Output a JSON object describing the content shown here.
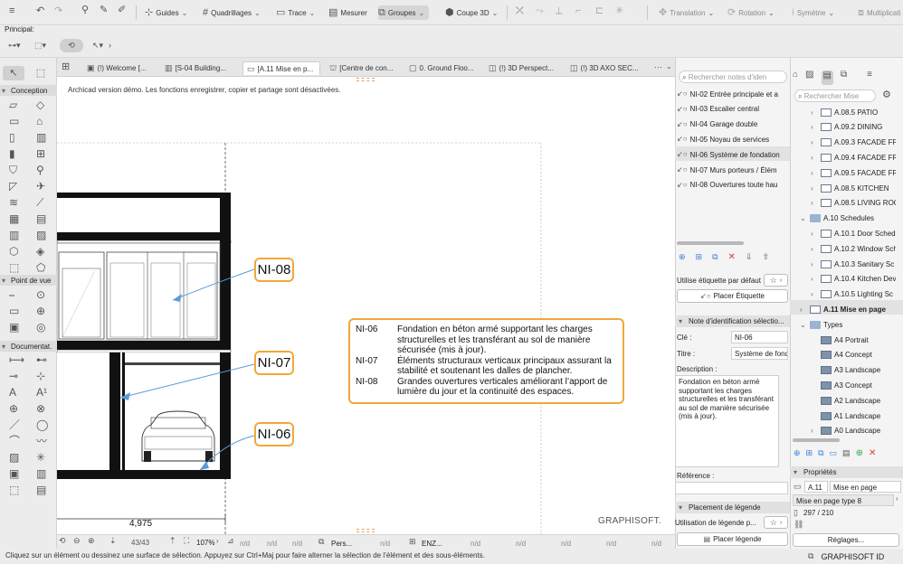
{
  "toolbar": {
    "guides": "Guides",
    "quadrillages": "Quadrillages",
    "trace": "Trace",
    "mesurer": "Mesurer",
    "groupes": "Groupes",
    "coupe3d": "Coupe 3D",
    "translation": "Translation",
    "rotation": "Rotation",
    "symetrie": "Symétrie",
    "multiplication": "Multiplicati"
  },
  "info_box": {
    "label": "Principal:"
  },
  "tabs": [
    {
      "label": "(!) Welcome [..."
    },
    {
      "label": "[S-04 Building..."
    },
    {
      "label": "[A.11 Mise en p..."
    },
    {
      "label": "[Centre de con..."
    },
    {
      "label": "0. Ground Floo..."
    },
    {
      "label": "(!) 3D Perspect..."
    },
    {
      "label": "(!) 3D AXO SEC..."
    }
  ],
  "toolbox": {
    "conception": "Conception",
    "point_de_vue": "Point de vue",
    "documentation": "Documentat."
  },
  "canvas": {
    "demo_notice": "Archicad version démo. Les fonctions enregistrer, copier et partage sont désactivées.",
    "dimension": "4,975",
    "watermark": "GRAPHISOFT.",
    "tags": [
      "NI-08",
      "NI-07",
      "NI-06"
    ],
    "legend": [
      {
        "key": "NI-06",
        "text": "Fondation en béton armé supportant les charges structurelles et les transférant au sol de manière sécurisée (mis à jour)."
      },
      {
        "key": "NI-07",
        "text": "Éléments structuraux verticaux principaux assurant la stabilité et soutenant les dalles de plancher."
      },
      {
        "key": "NI-08",
        "text": "Grandes ouvertures verticales améliorant l’apport de lumière du jour et la continuité des espaces."
      }
    ]
  },
  "status_bar": {
    "page": "43/43",
    "zoom": "107%",
    "na": "n/d",
    "pers": "Pers...",
    "enz": "ENZ..."
  },
  "bottom_hint": "Cliquez sur un élément ou dessinez une surface de sélection. Appuyez sur Ctrl+Maj pour faire alterner la sélection de l’élément et des sous-éléments.",
  "notes_panel": {
    "search_placeholder": "Rechercher notes d'iden",
    "items": [
      "NI-02 Entrée principale et a",
      "NI-03 Escalier central",
      "NI-04 Garage double",
      "NI-05 Noyau de services",
      "NI-06 Système de fondation",
      "NI-07 Murs porteurs / Élém",
      "NI-08 Ouvertures toute hau"
    ],
    "default_tag": "Utilise étiquette par défaut",
    "place_tag": "Placer Étiquette",
    "section_title": "Note d'identification sélectio...",
    "cle_label": "Clé :",
    "cle_value": "NI-06",
    "titre_label": "Titre :",
    "titre_value": "Système de fond",
    "description_label": "Description :",
    "description_value": "Fondation en béton armé supportant les charges structurelles et les transférant au sol de manière sécurisée (mis à jour).",
    "reference_label": "Référence :",
    "placement_title": "Placement de légende",
    "usage_label": "Utilisation de légende p...",
    "place_legend": "Placer légende"
  },
  "navigator": {
    "search_placeholder": "Rechercher Mise",
    "items": [
      "A.08.5 PATIO",
      "A.09.2 DINING",
      "A.09.3 FACADE FR",
      "A.09.4 FACADE FR",
      "A.09.5 FACADE FR",
      "A.08.5 KITCHEN",
      "A.08.5 LIVING ROO",
      "A.10 Schedules",
      "A.10.1 Door Sched",
      "A.10.2 Window Sch",
      "A.10.3 Sanitary Sc",
      "A.10.4 Kitchen Dev",
      "A.10.5 Lighting Sc",
      "A.11 Mise en page",
      "Types",
      "A4 Portrait",
      "A4 Concept",
      "A3 Landscape",
      "A3 Concept",
      "A2 Landscape",
      "A1 Landscape",
      "A0 Landscape"
    ],
    "properties_title": "Propriétés",
    "prop_id": "A.11",
    "prop_name": "Mise en page",
    "prop_type": "Mise en page type 8",
    "prop_size": "297 / 210",
    "reglages": "Réglages...",
    "brand": "GRAPHISOFT ID"
  },
  "colors": {
    "accent": "#f2a73a",
    "arrow": "#5b9ad8",
    "selection": "#e2e2e2"
  }
}
